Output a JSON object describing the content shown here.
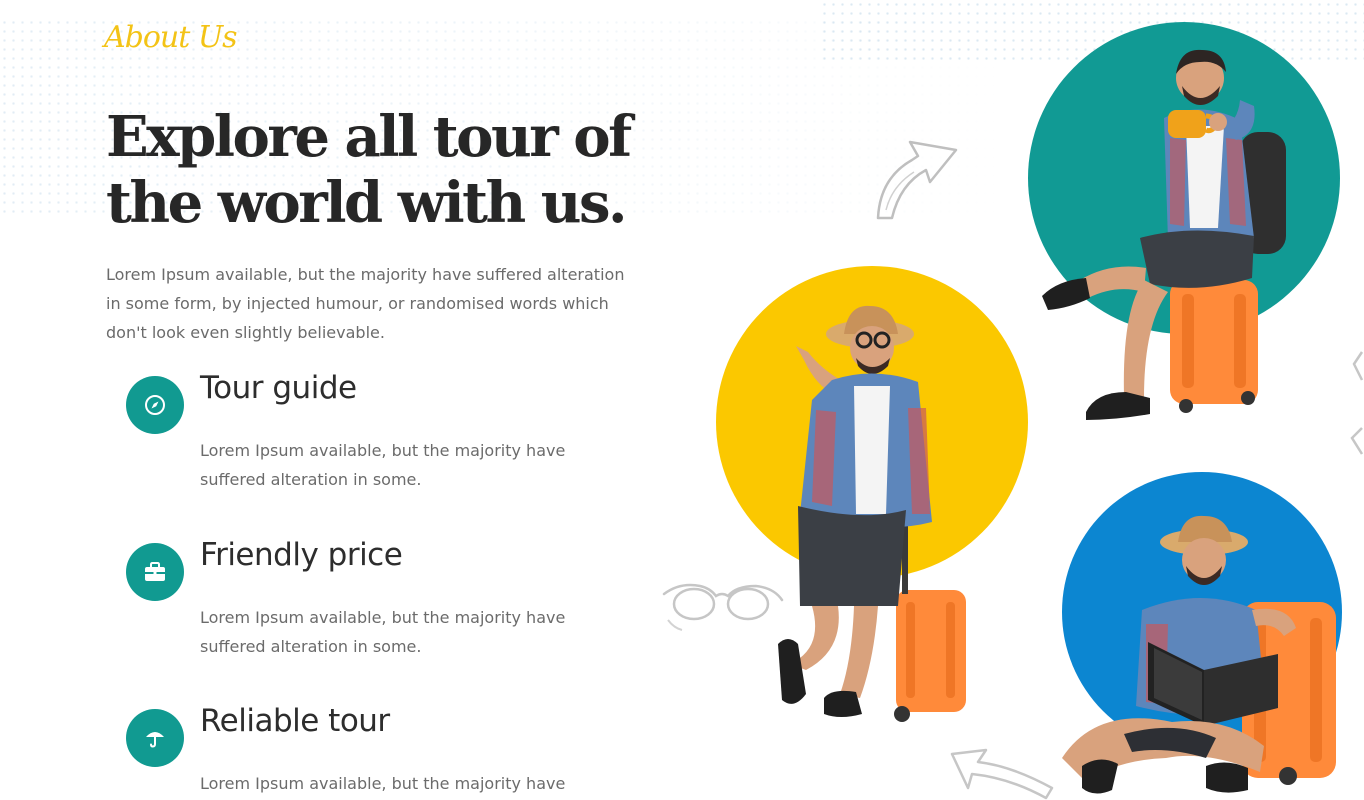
{
  "about": {
    "eyebrow": "About Us",
    "title": "Explore all tour of the world with us.",
    "intro": "Lorem Ipsum available, but the majority have suffered alteration in some form, by injected humour, or randomised words which don't look even slightly believable."
  },
  "features": [
    {
      "icon": "compass-icon",
      "title": "Tour guide",
      "text": "Lorem Ipsum available, but the majority have suffered alteration in some."
    },
    {
      "icon": "briefcase-icon",
      "title": "Friendly price",
      "text": "Lorem Ipsum available, but the majority have suffered alteration in some."
    },
    {
      "icon": "umbrella-icon",
      "title": "Reliable tour",
      "text": "Lorem Ipsum available, but the majority have"
    }
  ],
  "colors": {
    "accent_teal": "#119a91",
    "accent_yellow": "#fbc800",
    "accent_blue": "#0c86d1",
    "eyebrow_gold": "#f3c316",
    "luggage_orange": "#ff8a3a"
  }
}
